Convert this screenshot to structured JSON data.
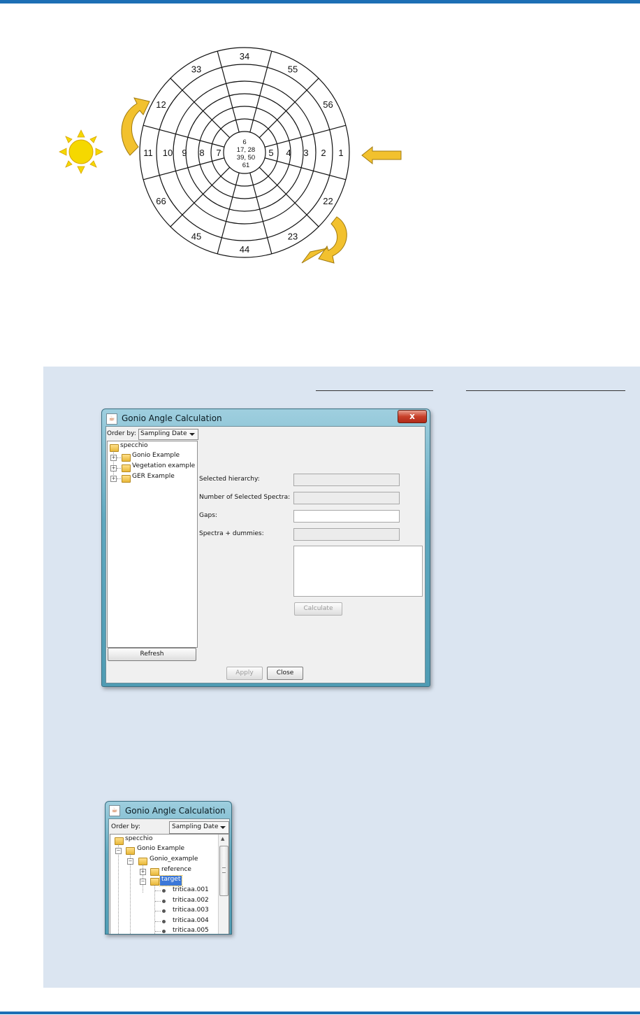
{
  "diagram": {
    "sector_numbers": [
      "34",
      "55",
      "56",
      "1",
      "22",
      "23",
      "44",
      "45",
      "66",
      "11",
      "12",
      "33"
    ],
    "horizontal_numbers": [
      "2",
      "3",
      "4",
      "5",
      "7",
      "8",
      "9",
      "10"
    ],
    "center_lines": [
      "6",
      "17, 28",
      "39, 50",
      "61"
    ],
    "colors": {
      "sun": "#f5d800",
      "arrow": "#f2c12e"
    }
  },
  "window1": {
    "title": "Gonio Angle Calculation",
    "close_glyph": "x",
    "order_by_label": "Order by:",
    "order_by_value": "Sampling Date",
    "tree_root": "specchio",
    "tree_items": [
      "Gonio Example",
      "Vegetation example",
      "GER Example"
    ],
    "refresh_label": "Refresh",
    "form": {
      "selected_hierarchy_label": "Selected hierarchy:",
      "num_selected_label": "Number of Selected Spectra:",
      "gaps_label": "Gaps:",
      "spectra_dummies_label": "Spectra + dummies:"
    },
    "calculate_label": "Calculate",
    "apply_label": "Apply",
    "close_label": "Close"
  },
  "window2": {
    "title": "Gonio Angle Calculation",
    "order_by_label": "Order by:",
    "order_by_value": "Sampling Date",
    "tree_root": "specchio",
    "tree_level1": "Gonio Example",
    "tree_level2": "Gonio_example",
    "tree_level3": [
      "reference",
      "target"
    ],
    "tree_leaves": [
      "triticaa.001",
      "triticaa.002",
      "triticaa.003",
      "triticaa.004",
      "triticaa.005"
    ]
  }
}
